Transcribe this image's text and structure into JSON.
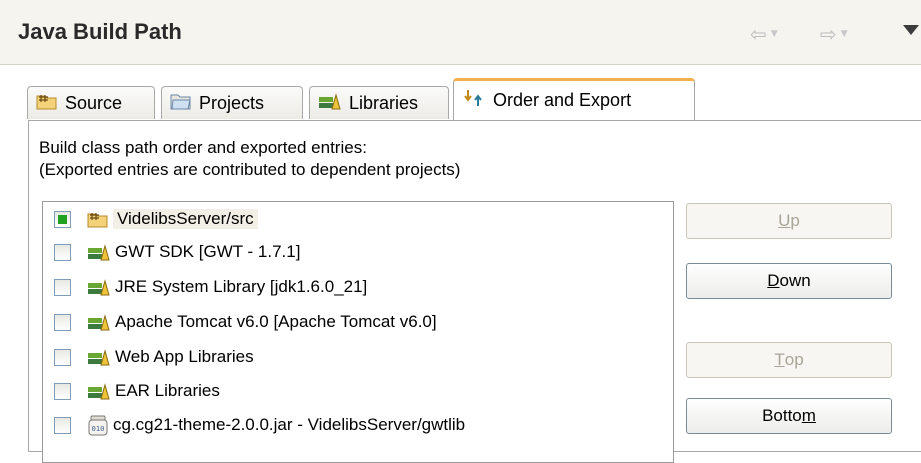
{
  "header": {
    "title": "Java Build Path"
  },
  "tabs": [
    {
      "label": "Source",
      "icon": "source-folder-icon",
      "active": false
    },
    {
      "label": "Projects",
      "icon": "projects-folder-icon",
      "active": false
    },
    {
      "label": "Libraries",
      "icon": "libraries-icon",
      "active": false
    },
    {
      "label": "Order and Export",
      "icon": "order-export-icon",
      "active": true
    }
  ],
  "description": {
    "line1": "Build class path order and exported entries:",
    "line2": "(Exported entries are contributed to dependent projects)"
  },
  "entries": [
    {
      "label": "VidelibsServer/src",
      "icon": "source-folder-icon",
      "checked": true,
      "selected": true
    },
    {
      "label": "GWT SDK [GWT - 1.7.1]",
      "icon": "library-icon",
      "checked": false
    },
    {
      "label": "JRE System Library [jdk1.6.0_21]",
      "icon": "library-icon",
      "checked": false
    },
    {
      "label": "Apache Tomcat v6.0 [Apache Tomcat v6.0]",
      "icon": "library-icon",
      "checked": false
    },
    {
      "label": "Web App Libraries",
      "icon": "library-icon",
      "checked": false
    },
    {
      "label": "EAR Libraries",
      "icon": "library-icon",
      "checked": false
    },
    {
      "label": "cg.cg21-theme-2.0.0.jar - VidelibsServer/gwtlib",
      "icon": "jar-icon",
      "checked": false
    }
  ],
  "buttons": {
    "up": {
      "before": "",
      "key": "U",
      "after": "p",
      "enabled": false
    },
    "down": {
      "before": "",
      "key": "D",
      "after": "own",
      "enabled": true
    },
    "top": {
      "before": "",
      "key": "T",
      "after": "op",
      "enabled": false
    },
    "bottom": {
      "before": "Botto",
      "key": "m",
      "after": "",
      "enabled": true
    }
  },
  "colors": {
    "accent_tab": "#f2b14a",
    "checked": "#21a121",
    "disabled_text": "#a8a699"
  }
}
